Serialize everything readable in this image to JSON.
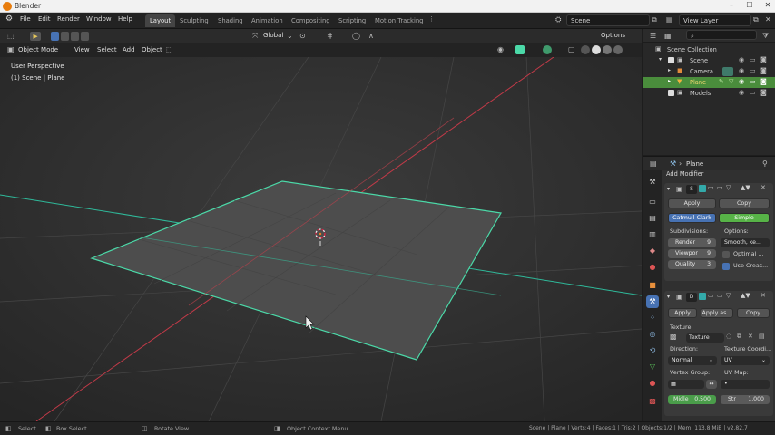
{
  "app": {
    "title": "Blender"
  },
  "menu": [
    "File",
    "Edit",
    "Render",
    "Window",
    "Help"
  ],
  "workspaces": [
    "Layout",
    "Sculpting",
    "Shading",
    "Animation",
    "Compositing",
    "Scripting",
    "Motion Tracking"
  ],
  "scene_selector": {
    "value": "Scene"
  },
  "view_layer_selector": {
    "value": "View Layer"
  },
  "tool_header": {
    "orientation": "Global",
    "options_label": "Options"
  },
  "viewport_header": {
    "mode": "Object Mode",
    "view": "View",
    "select": "Select",
    "add": "Add",
    "object": "Object"
  },
  "viewport": {
    "perspective_label": "User Perspective",
    "context_label": "(1) Scene | Plane"
  },
  "outliner": {
    "items": [
      {
        "label": "Scene Collection",
        "indent": 0
      },
      {
        "label": "Scene",
        "indent": 1
      },
      {
        "label": "Camera",
        "indent": 2
      },
      {
        "label": "Plane",
        "indent": 2,
        "selected": true
      },
      {
        "label": "Models",
        "indent": 1
      }
    ]
  },
  "properties": {
    "object_name": "Plane",
    "add_modifier": "Add Modifier",
    "subsurf": {
      "name_short": "S",
      "apply": "Apply",
      "copy": "Copy",
      "catmull": "Catmull-Clark",
      "simple": "Simple",
      "subdivisions_label": "Subdivisions:",
      "options_label": "Options:",
      "render_label": "Render",
      "render_value": "9",
      "viewport_label": "Viewpor",
      "viewport_value": "9",
      "quality_label": "Quality",
      "quality_value": "3",
      "uv_smooth": "Smooth, ke...",
      "optimal": "Optimal ...",
      "use_crease": "Use Creas..."
    },
    "displace": {
      "name_short": "D",
      "apply": "Apply",
      "apply_as": "Apply as...",
      "copy": "Copy",
      "texture_label": "Texture:",
      "texture_value": "Texture",
      "direction_label": "Direction:",
      "texture_coords_label": "Texture Coordi...",
      "direction_value": "Normal",
      "coords_value": "UV",
      "vertex_group_label": "Vertex Group:",
      "uv_map_label": "UV Map:",
      "uv_map_value": "•",
      "midlevel_label": "Midle",
      "midlevel_value": "0.500",
      "strength_label": "Str",
      "strength_value": "1.000"
    }
  },
  "statusbar": {
    "select": "Select",
    "box_select": "Box Select",
    "rotate_view": "Rotate View",
    "context_menu": "Object Context Menu",
    "stats": "Scene | Plane | Verts:4 | Faces:1 | Tris:2 | Objects:1/2 | Mem: 113.8 MiB | v2.82.7"
  },
  "colors": {
    "selection": "#4bd9a8",
    "axis_x": "#c23a48",
    "axis_y": "#2fb99a",
    "plane": "#4d4d4d",
    "accent_blue": "#4772b3"
  }
}
